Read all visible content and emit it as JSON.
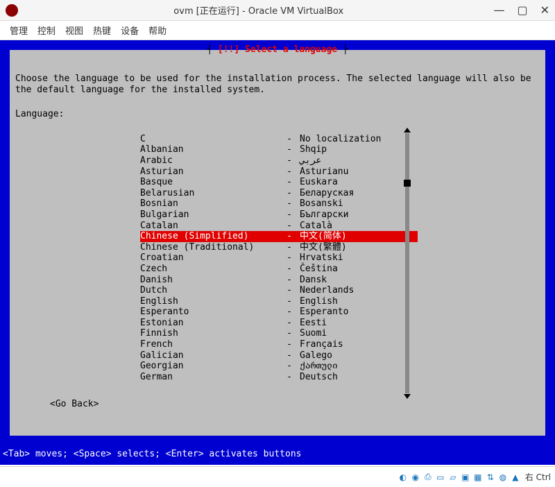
{
  "titlebar": {
    "title": "ovm [正在运行] - Oracle VM VirtualBox"
  },
  "menu": {
    "items": [
      "管理",
      "控制",
      "视图",
      "热键",
      "设备",
      "帮助"
    ]
  },
  "dialog": {
    "title": "[!!] Select a language",
    "instruction": "Choose the language to be used for the installation process. The selected language will also be the default language for the installed system.",
    "label": "Language:",
    "go_back": "<Go Back>"
  },
  "languages": [
    {
      "name": "C",
      "native": "No localization",
      "selected": false
    },
    {
      "name": "Albanian",
      "native": "Shqip",
      "selected": false
    },
    {
      "name": "Arabic",
      "native": "عربي",
      "selected": false
    },
    {
      "name": "Asturian",
      "native": "Asturianu",
      "selected": false
    },
    {
      "name": "Basque",
      "native": "Euskara",
      "selected": false
    },
    {
      "name": "Belarusian",
      "native": "Беларуская",
      "selected": false
    },
    {
      "name": "Bosnian",
      "native": "Bosanski",
      "selected": false
    },
    {
      "name": "Bulgarian",
      "native": "Български",
      "selected": false
    },
    {
      "name": "Catalan",
      "native": "Català",
      "selected": false
    },
    {
      "name": "Chinese (Simplified)",
      "native": "中文(简体)",
      "selected": true
    },
    {
      "name": "Chinese (Traditional)",
      "native": "中文(繁體)",
      "selected": false
    },
    {
      "name": "Croatian",
      "native": "Hrvatski",
      "selected": false
    },
    {
      "name": "Czech",
      "native": "Čeština",
      "selected": false
    },
    {
      "name": "Danish",
      "native": "Dansk",
      "selected": false
    },
    {
      "name": "Dutch",
      "native": "Nederlands",
      "selected": false
    },
    {
      "name": "English",
      "native": "English",
      "selected": false
    },
    {
      "name": "Esperanto",
      "native": "Esperanto",
      "selected": false
    },
    {
      "name": "Estonian",
      "native": "Eesti",
      "selected": false
    },
    {
      "name": "Finnish",
      "native": "Suomi",
      "selected": false
    },
    {
      "name": "French",
      "native": "Français",
      "selected": false
    },
    {
      "name": "Galician",
      "native": "Galego",
      "selected": false
    },
    {
      "name": "Georgian",
      "native": "ქართული",
      "selected": false
    },
    {
      "name": "German",
      "native": "Deutsch",
      "selected": false
    }
  ],
  "footer_help": "<Tab> moves; <Space> selects; <Enter> activates buttons",
  "statusbar": {
    "host_key": "右 Ctrl"
  }
}
